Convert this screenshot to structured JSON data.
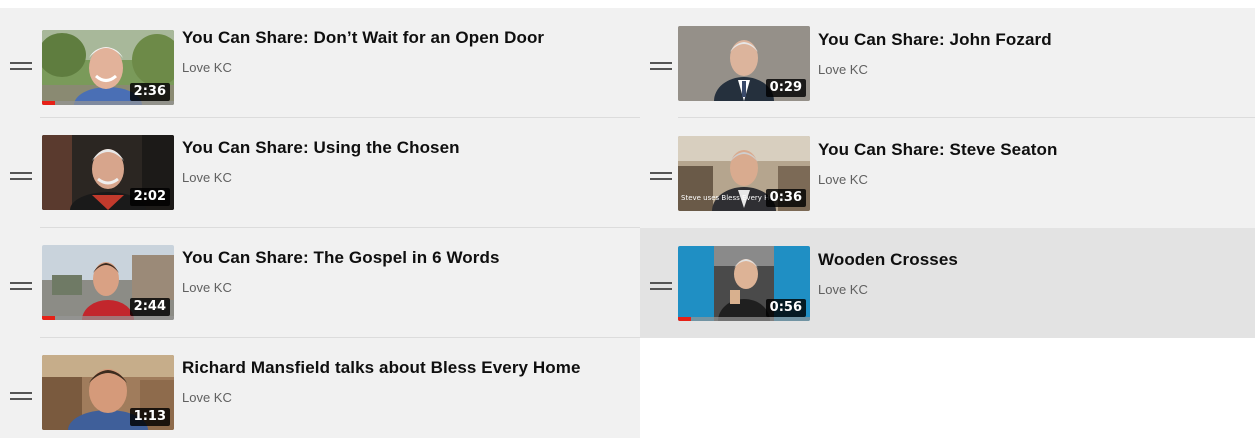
{
  "left_column": [
    {
      "title": "You Can Share: Don’t Wait for an Open Door",
      "channel": "Love KC",
      "duration": "2:36",
      "progress": 0.1,
      "thumb": "thumb-yard"
    },
    {
      "title": "You Can Share: Using the Chosen",
      "channel": "Love KC",
      "duration": "2:02",
      "progress": 0,
      "thumb": "thumb-car"
    },
    {
      "title": "You Can Share: The Gospel in 6 Words",
      "channel": "Love KC",
      "duration": "2:44",
      "progress": 0.1,
      "thumb": "thumb-outdoor"
    },
    {
      "title": "Richard Mansfield talks about Bless Every Home",
      "channel": "Love KC",
      "duration": "1:13",
      "progress": 0,
      "thumb": "thumb-office"
    }
  ],
  "right_column": [
    {
      "title": "You Can Share: John Fozard",
      "channel": "Love KC",
      "duration": "0:29",
      "progress": 0,
      "thumb": "thumb-wall"
    },
    {
      "title": "You Can Share: Steve Seaton",
      "channel": "Love KC",
      "duration": "0:36",
      "progress": 0,
      "thumb": "thumb-room",
      "caption": "Steve uses Bless Every Home"
    },
    {
      "title": "Wooden Crosses",
      "channel": "Love KC",
      "duration": "0:56",
      "progress": 0.1,
      "thumb": "thumb-blue",
      "highlighted": true
    }
  ],
  "colors": {
    "progress_fill": "#e62117",
    "row_bg": "#f1f1f1",
    "row_highlight": "#e3e3e3"
  }
}
